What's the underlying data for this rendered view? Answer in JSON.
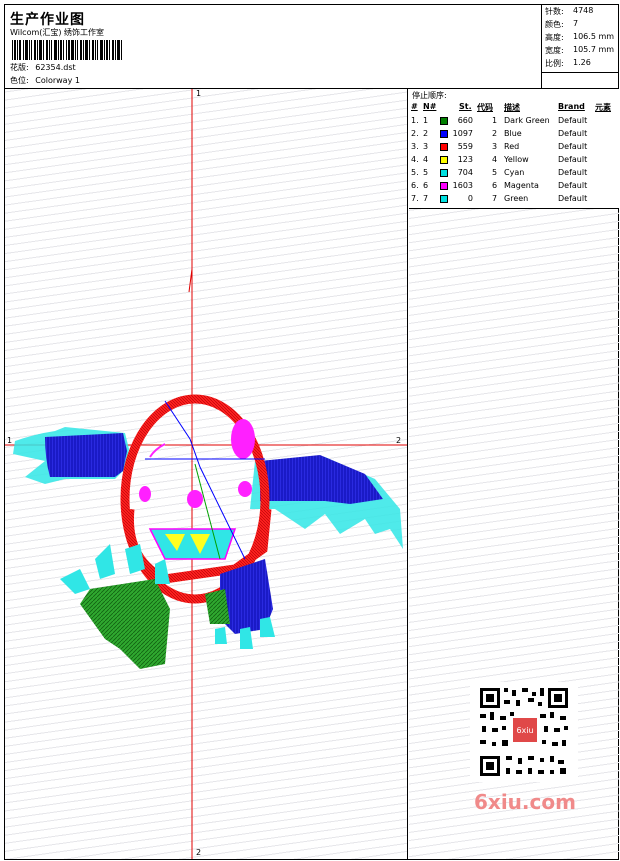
{
  "header": {
    "title": "生产作业图",
    "studio": "Wilcom(汇宝) 绣饰工作室",
    "design_label": "花版:",
    "design_value": "62354.dst",
    "colorway_label": "色位:",
    "colorway_value": "Colorway 1"
  },
  "info": {
    "stitches_label": "针数:",
    "stitches_value": "4748",
    "colors_label": "颜色:",
    "colors_value": "7",
    "height_label": "高度:",
    "height_value": "106.5 mm",
    "width_label": "宽度:",
    "width_value": "105.7 mm",
    "ratio_label": "比例:",
    "ratio_value": "1.26"
  },
  "stop_table": {
    "title": "停止顺序:",
    "headers": {
      "idx": "#",
      "no": "N#",
      "stitches": "St.",
      "code": "代码",
      "desc": "描述",
      "brand": "Brand",
      "elem": "元素"
    },
    "rows": [
      {
        "idx": "1.",
        "no": "1",
        "color": "#008000",
        "stitches": "660",
        "code": "1",
        "desc": "Dark Green",
        "brand": "Default"
      },
      {
        "idx": "2.",
        "no": "2",
        "color": "#0000ff",
        "stitches": "1097",
        "code": "2",
        "desc": "Blue",
        "brand": "Default"
      },
      {
        "idx": "3.",
        "no": "3",
        "color": "#ff0000",
        "stitches": "559",
        "code": "3",
        "desc": "Red",
        "brand": "Default"
      },
      {
        "idx": "4.",
        "no": "4",
        "color": "#ffff00",
        "stitches": "123",
        "code": "4",
        "desc": "Yellow",
        "brand": "Default"
      },
      {
        "idx": "5.",
        "no": "5",
        "color": "#00e0e0",
        "stitches": "704",
        "code": "5",
        "desc": "Cyan",
        "brand": "Default"
      },
      {
        "idx": "6.",
        "no": "6",
        "color": "#ff00ff",
        "stitches": "1603",
        "code": "6",
        "desc": "Magenta",
        "brand": "Default"
      },
      {
        "idx": "7.",
        "no": "7",
        "color": "#00e0e0",
        "stitches": "0",
        "code": "7",
        "desc": "Green",
        "brand": "Default"
      }
    ]
  },
  "axes": {
    "top": "1",
    "left": "1",
    "right": "2",
    "bottom": "2"
  },
  "watermark": {
    "text": "6xiu.com",
    "qr_text": "6xiu"
  }
}
